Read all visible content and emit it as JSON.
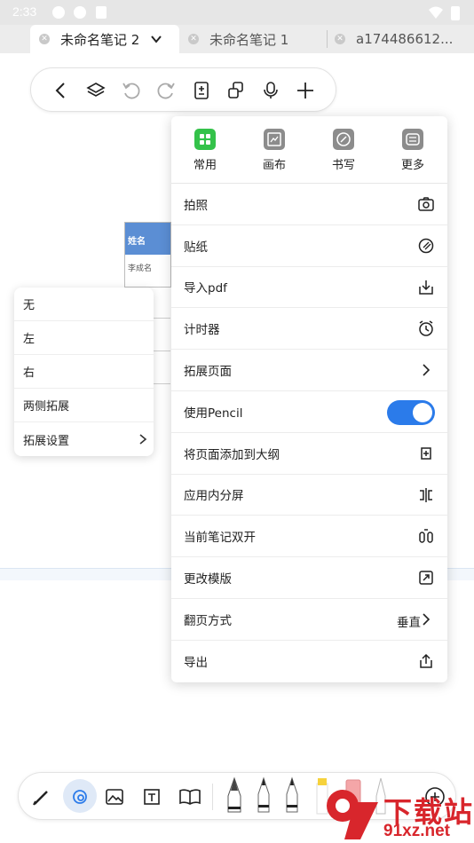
{
  "status_bar": {
    "time": "2:33"
  },
  "tabs": [
    {
      "label": "未命名笔记 2",
      "active": true
    },
    {
      "label": "未命名笔记 1",
      "active": false
    },
    {
      "label": "a174486612...",
      "active": false
    }
  ],
  "toolbar": {
    "icons": [
      "back-icon",
      "layers-icon",
      "undo-icon",
      "redo-icon",
      "page-number-icon",
      "duplicate-icon",
      "microphone-icon",
      "add-icon"
    ]
  },
  "canvas": {
    "table_header": "姓名",
    "table_cell": "李成名"
  },
  "extend_menu": {
    "items": [
      {
        "label": "无"
      },
      {
        "label": "左"
      },
      {
        "label": "右"
      },
      {
        "label": "两侧拓展"
      },
      {
        "label": "拓展设置",
        "has_submenu": true
      }
    ]
  },
  "dropdown": {
    "categories": [
      {
        "label": "常用",
        "icon": "grid-icon",
        "color": "#34c24a",
        "selected": true
      },
      {
        "label": "画布",
        "icon": "canvas-icon",
        "color": "#8c8c8c",
        "selected": false
      },
      {
        "label": "书写",
        "icon": "pen-icon",
        "color": "#8c8c8c",
        "selected": false
      },
      {
        "label": "更多",
        "icon": "sliders-icon",
        "color": "#8c8c8c",
        "selected": false
      }
    ],
    "items": [
      {
        "label": "拍照",
        "icon": "camera-icon"
      },
      {
        "label": "贴纸",
        "icon": "sticker-icon"
      },
      {
        "label": "导入pdf",
        "icon": "import-icon"
      },
      {
        "label": "计时器",
        "icon": "alarm-icon"
      },
      {
        "label": "拓展页面",
        "icon": "chevron-right-icon"
      },
      {
        "label": "使用Pencil",
        "icon": "toggle",
        "toggle_on": true
      },
      {
        "label": "将页面添加到大纲",
        "icon": "outline-add-icon"
      },
      {
        "label": "应用内分屏",
        "icon": "split-screen-icon"
      },
      {
        "label": "当前笔记双开",
        "icon": "dual-open-icon"
      },
      {
        "label": "更改模版",
        "icon": "template-icon"
      },
      {
        "label": "翻页方式",
        "value": "垂直",
        "icon": "chevron-right-icon"
      },
      {
        "label": "导出",
        "icon": "share-icon"
      }
    ]
  },
  "bottom_toolbar": {
    "icons": [
      "pencil-icon",
      "lasso-icon",
      "image-icon",
      "text-box-icon",
      "book-icon",
      "fountain-pen-icon",
      "pen-icon",
      "marker-icon",
      "highlighter-icon",
      "eraser-icon",
      "brush-icon",
      "color-add-icon"
    ]
  },
  "watermark": {
    "text": "下载站",
    "url": "91xz.net"
  },
  "colors": {
    "accent": "#2b7bea",
    "table_header": "#5b8ed4",
    "watermark": "#d8262c"
  }
}
